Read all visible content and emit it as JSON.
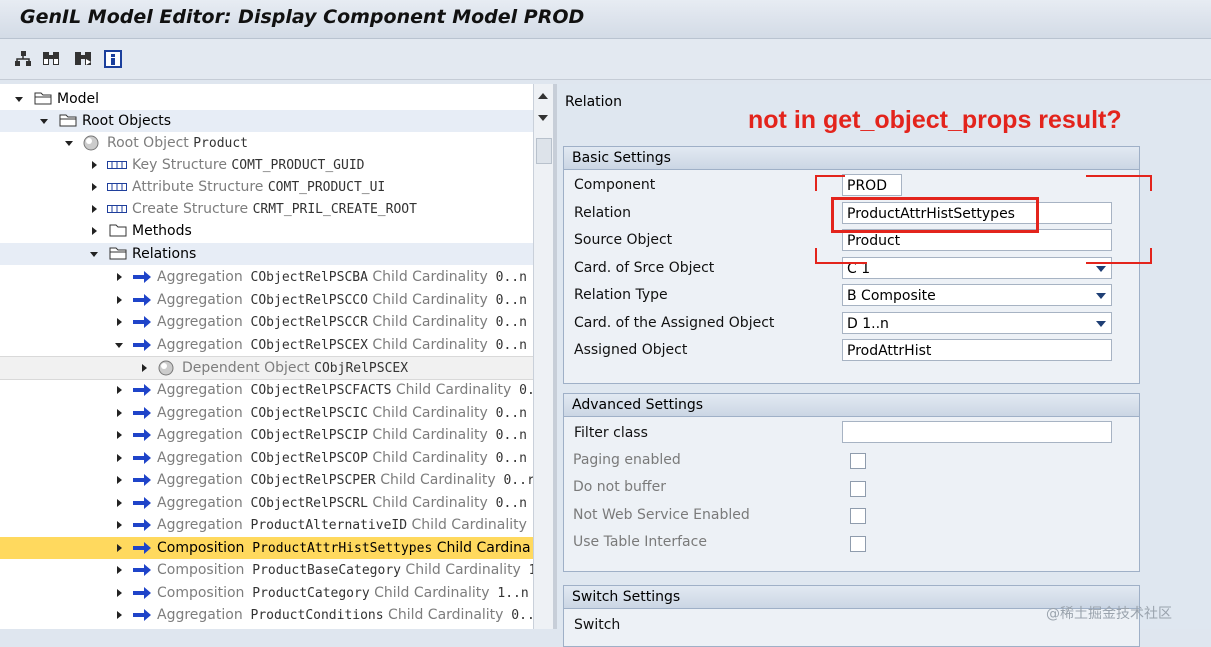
{
  "window": {
    "title": "GenIL Model Editor: Display Component Model PROD"
  },
  "toolbar": {
    "icons": [
      "hierarchy-icon",
      "find-icon",
      "find-next-icon",
      "info-icon"
    ]
  },
  "tree": {
    "model": "Model",
    "root_objects": "Root Objects",
    "root_object": {
      "type": "Root Object",
      "name": "Product"
    },
    "key_structure": {
      "type": "Key Structure",
      "name": "COMT_PRODUCT_GUID"
    },
    "attribute_structure": {
      "type": "Attribute Structure",
      "name": "COMT_PRODUCT_UI"
    },
    "create_structure": {
      "type": "Create Structure",
      "name": "CRMT_PRIL_CREATE_ROOT"
    },
    "methods": "Methods",
    "relations": "Relations",
    "rel_rows": [
      {
        "kind": "Aggregation",
        "name": "CObjectRelPSCBA",
        "card_label": "Child Cardinality",
        "card": "0..n"
      },
      {
        "kind": "Aggregation",
        "name": "CObjectRelPSCCO",
        "card_label": "Child Cardinality",
        "card": "0..n"
      },
      {
        "kind": "Aggregation",
        "name": "CObjectRelPSCCR",
        "card_label": "Child Cardinality",
        "card": "0..n"
      },
      {
        "kind": "Aggregation",
        "name": "CObjectRelPSCEX",
        "card_label": "Child Cardinality",
        "card": "0..n"
      }
    ],
    "dependent": {
      "type": "Dependent Object",
      "name": "CObjRelPSCEX"
    },
    "rel_rows2": [
      {
        "kind": "Aggregation",
        "name": "CObjectRelPSCFACTS",
        "card_label": "Child Cardinality",
        "card": "0."
      },
      {
        "kind": "Aggregation",
        "name": "CObjectRelPSCIC",
        "card_label": "Child Cardinality",
        "card": "0..n"
      },
      {
        "kind": "Aggregation",
        "name": "CObjectRelPSCIP",
        "card_label": "Child Cardinality",
        "card": "0..n"
      },
      {
        "kind": "Aggregation",
        "name": "CObjectRelPSCOP",
        "card_label": "Child Cardinality",
        "card": "0..n"
      },
      {
        "kind": "Aggregation",
        "name": "CObjectRelPSCPER",
        "card_label": "Child Cardinality",
        "card": "0..r"
      },
      {
        "kind": "Aggregation",
        "name": "CObjectRelPSCRL",
        "card_label": "Child Cardinality",
        "card": "0..n"
      },
      {
        "kind": "Aggregation",
        "name": "ProductAlternativeID",
        "card_label": "Child Cardinality",
        "card": ""
      },
      {
        "kind": "Composition",
        "name": "ProductAttrHistSettypes",
        "card_label": "Child Cardina",
        "card": ""
      },
      {
        "kind": "Composition",
        "name": "ProductBaseCategory",
        "card_label": "Child Cardinality",
        "card": "1"
      },
      {
        "kind": "Composition",
        "name": "ProductCategory",
        "card_label": "Child Cardinality",
        "card": "1..n"
      },
      {
        "kind": "Aggregation",
        "name": "ProductConditions",
        "card_label": "Child Cardinality",
        "card": "0.."
      }
    ]
  },
  "detail": {
    "heading": "Relation",
    "annotation": "not in get_object_props result?",
    "basic": {
      "title": "Basic Settings",
      "component_label": "Component",
      "component": "PROD",
      "relation_label": "Relation",
      "relation": "ProductAttrHistSettypes",
      "source_label": "Source Object",
      "source": "Product",
      "card_src_label": "Card. of Srce Object",
      "card_src": "C 1",
      "rel_type_label": "Relation Type",
      "rel_type": "B Composite",
      "card_assigned_label": "Card. of the Assigned Object",
      "card_assigned": "D 1..n",
      "assigned_label": "Assigned Object",
      "assigned": "ProdAttrHist"
    },
    "advanced": {
      "title": "Advanced Settings",
      "filter_label": "Filter class",
      "filter": "",
      "paging_label": "Paging enabled",
      "buffer_label": "Do not buffer",
      "websvc_label": "Not Web Service Enabled",
      "table_label": "Use Table Interface"
    },
    "switch": {
      "title": "Switch Settings",
      "switch_label": "Switch"
    }
  },
  "watermark": "@稀土掘金技术社区",
  "colors": {
    "selection": "#ffd95e",
    "annotation": "#e3241c",
    "arrow": "#1f44c9"
  }
}
